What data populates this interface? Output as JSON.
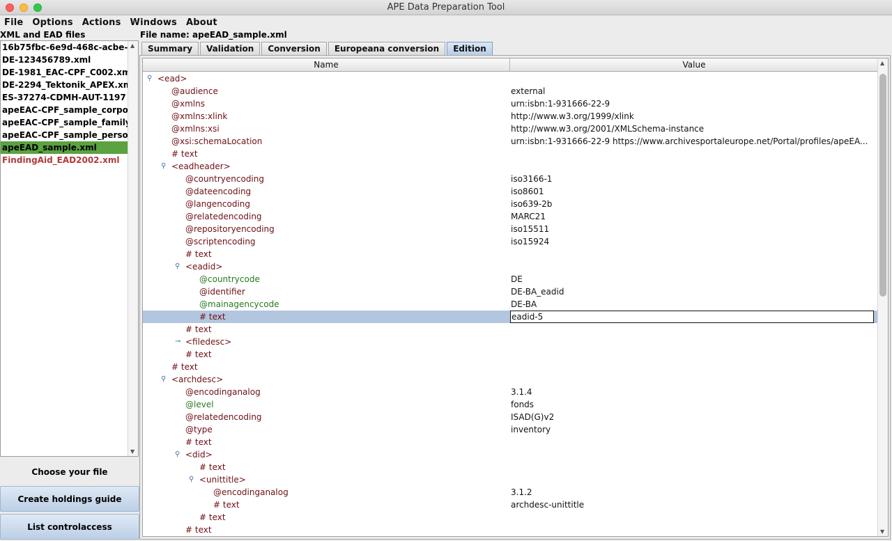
{
  "window": {
    "title": "APE Data Preparation Tool"
  },
  "menu": [
    "File",
    "Options",
    "Actions",
    "Windows",
    "About"
  ],
  "left_panel": {
    "header": "XML and EAD files",
    "files": [
      {
        "name": "16b75fbc-6e9d-468c-acbe-",
        "state": "normal"
      },
      {
        "name": "DE-123456789.xml",
        "state": "normal"
      },
      {
        "name": "DE-1981_EAC-CPF_C002.xm",
        "state": "normal"
      },
      {
        "name": "DE-2294_Tektonik_APEX.xml",
        "state": "normal"
      },
      {
        "name": "ES-37274-CDMH-AUT-1197",
        "state": "normal"
      },
      {
        "name": "apeEAC-CPF_sample_corpora",
        "state": "normal"
      },
      {
        "name": "apeEAC-CPF_sample_family.x",
        "state": "normal"
      },
      {
        "name": "apeEAC-CPF_sample_person.",
        "state": "normal"
      },
      {
        "name": "apeEAD_sample.xml",
        "state": "selected"
      },
      {
        "name": "FindingAid_EAD2002.xml",
        "state": "error"
      }
    ],
    "buttons": {
      "choose": "Choose your file",
      "holdings": "Create holdings guide",
      "controlaccess": "List controlaccess"
    }
  },
  "main": {
    "file_name_label": "File name: apeEAD_sample.xml",
    "tabs": [
      "Summary",
      "Validation",
      "Conversion",
      "Europeana conversion",
      "Edition"
    ],
    "active_tab": "Edition",
    "columns": {
      "name": "Name",
      "value": "Value"
    },
    "rows": [
      {
        "name": "<ead>",
        "value": "",
        "kind": "elem",
        "depth": 0,
        "toggle": "expanded"
      },
      {
        "name": "@audience",
        "value": "external",
        "kind": "attr",
        "depth": 1
      },
      {
        "name": "@xmlns",
        "value": "urn:isbn:1-931666-22-9",
        "kind": "attr",
        "depth": 1
      },
      {
        "name": "@xmlns:xlink",
        "value": "http://www.w3.org/1999/xlink",
        "kind": "attr",
        "depth": 1
      },
      {
        "name": "@xmlns:xsi",
        "value": "http://www.w3.org/2001/XMLSchema-instance",
        "kind": "attr",
        "depth": 1
      },
      {
        "name": "@xsi:schemaLocation",
        "value": "urn:isbn:1-931666-22-9 https://www.archivesportaleurope.net/Portal/profiles/apeEA...",
        "kind": "attr",
        "depth": 1
      },
      {
        "name": "# text",
        "value": "",
        "kind": "txt",
        "depth": 1
      },
      {
        "name": "<eadheader>",
        "value": "",
        "kind": "elem",
        "depth": 1,
        "toggle": "expanded"
      },
      {
        "name": "@countryencoding",
        "value": "iso3166-1",
        "kind": "attr",
        "depth": 2
      },
      {
        "name": "@dateencoding",
        "value": "iso8601",
        "kind": "attr",
        "depth": 2
      },
      {
        "name": "@langencoding",
        "value": "iso639-2b",
        "kind": "attr",
        "depth": 2
      },
      {
        "name": "@relatedencoding",
        "value": "MARC21",
        "kind": "attr",
        "depth": 2
      },
      {
        "name": "@repositoryencoding",
        "value": "iso15511",
        "kind": "attr",
        "depth": 2
      },
      {
        "name": "@scriptencoding",
        "value": "iso15924",
        "kind": "attr",
        "depth": 2
      },
      {
        "name": "# text",
        "value": "",
        "kind": "txt",
        "depth": 2
      },
      {
        "name": "<eadid>",
        "value": "",
        "kind": "elem",
        "depth": 2,
        "toggle": "expanded"
      },
      {
        "name": "@countrycode",
        "value": "DE",
        "kind": "attr-g",
        "depth": 3
      },
      {
        "name": "@identifier",
        "value": "DE-BA_eadid",
        "kind": "attr",
        "depth": 3
      },
      {
        "name": "@mainagencycode",
        "value": "DE-BA",
        "kind": "attr-g",
        "depth": 3
      },
      {
        "name": "# text",
        "value": "eadid-5",
        "kind": "txt",
        "depth": 3,
        "selected": true
      },
      {
        "name": "# text",
        "value": "",
        "kind": "txt",
        "depth": 2
      },
      {
        "name": "<filedesc>",
        "value": "",
        "kind": "elem",
        "depth": 2,
        "toggle": "collapsed"
      },
      {
        "name": "# text",
        "value": "",
        "kind": "txt",
        "depth": 2
      },
      {
        "name": "# text",
        "value": "",
        "kind": "txt",
        "depth": 1
      },
      {
        "name": "<archdesc>",
        "value": "",
        "kind": "elem",
        "depth": 1,
        "toggle": "expanded"
      },
      {
        "name": "@encodinganalog",
        "value": "3.1.4",
        "kind": "attr",
        "depth": 2
      },
      {
        "name": "@level",
        "value": "fonds",
        "kind": "attr-g",
        "depth": 2
      },
      {
        "name": "@relatedencoding",
        "value": "ISAD(G)v2",
        "kind": "attr",
        "depth": 2
      },
      {
        "name": "@type",
        "value": "inventory",
        "kind": "attr",
        "depth": 2
      },
      {
        "name": "# text",
        "value": "",
        "kind": "txt",
        "depth": 2
      },
      {
        "name": "<did>",
        "value": "",
        "kind": "elem",
        "depth": 2,
        "toggle": "expanded"
      },
      {
        "name": "# text",
        "value": "",
        "kind": "txt",
        "depth": 3
      },
      {
        "name": "<unittitle>",
        "value": "",
        "kind": "elem",
        "depth": 3,
        "toggle": "expanded"
      },
      {
        "name": "@encodinganalog",
        "value": "3.1.2",
        "kind": "attr",
        "depth": 4
      },
      {
        "name": "# text",
        "value": "archdesc-unittitle",
        "kind": "txt",
        "depth": 4
      },
      {
        "name": "# text",
        "value": "",
        "kind": "txt",
        "depth": 3
      },
      {
        "name": "# text",
        "value": "",
        "kind": "txt",
        "depth": 2
      }
    ]
  }
}
